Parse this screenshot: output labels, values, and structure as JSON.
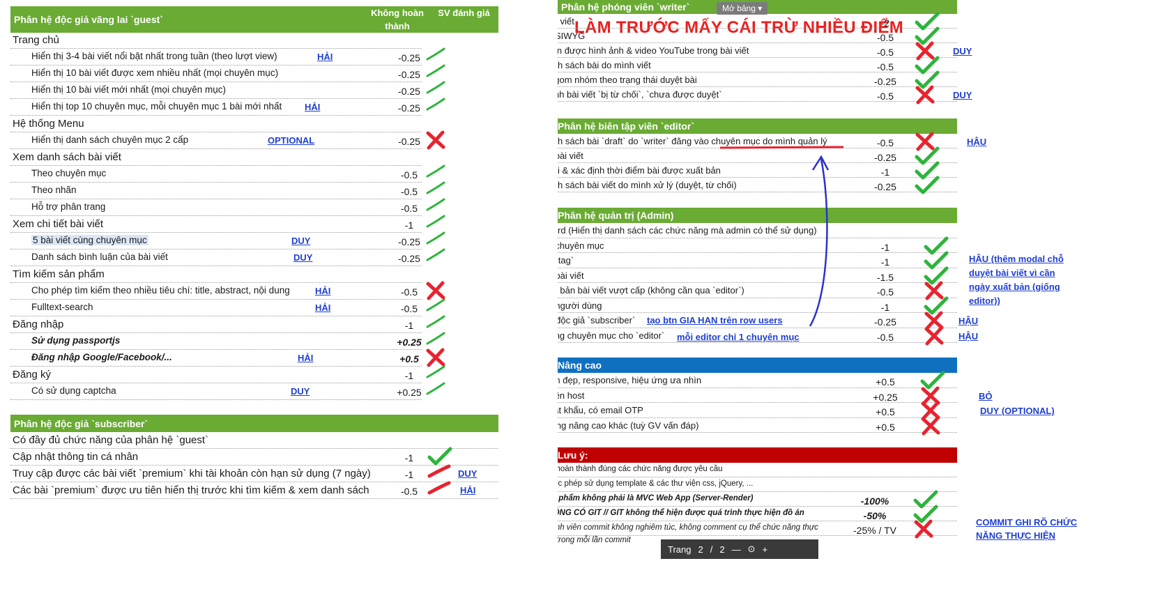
{
  "left": {
    "header1": {
      "title": "Phân hệ độc giả vãng lai `guest`",
      "col1": "Không hoàn thành",
      "col2": "SV đánh giá"
    },
    "rows": [
      {
        "type": "main",
        "label": "Trang chủ",
        "value": "",
        "mark": "",
        "note": ""
      },
      {
        "type": "sub",
        "label": "Hiển thị 3-4 bài viết nổi bật nhất trong tuần (theo lượt view)",
        "value": "-0.25",
        "mark": "green",
        "note": "HẢI"
      },
      {
        "type": "sub",
        "label": "Hiển thị 10 bài viết được xem nhiều nhất (mọi chuyên mục)",
        "value": "-0.25",
        "mark": "green",
        "note": ""
      },
      {
        "type": "sub",
        "label": "Hiển thị 10 bài viết mới nhất (mọi chuyên mục)",
        "value": "-0.25",
        "mark": "green",
        "note": ""
      },
      {
        "type": "sub",
        "label": "Hiển thị top 10 chuyên mục, mỗi chuyên mục 1 bài mới nhất",
        "value": "-0.25",
        "mark": "green",
        "note": "HẢI"
      },
      {
        "type": "main",
        "label": "Hệ thống Menu",
        "value": "",
        "mark": "",
        "note": ""
      },
      {
        "type": "sub",
        "label": "Hiển thị danh sách chuyên mục 2 cấp",
        "value": "-0.25",
        "mark": "red",
        "note": "OPTIONAL"
      },
      {
        "type": "main",
        "label": "Xem danh sách bài viết",
        "value": "",
        "mark": "",
        "note": ""
      },
      {
        "type": "sub",
        "label": "Theo chuyên mục",
        "value": "-0.5",
        "mark": "green",
        "note": ""
      },
      {
        "type": "sub",
        "label": "Theo nhãn",
        "value": "-0.5",
        "mark": "green",
        "note": ""
      },
      {
        "type": "sub",
        "label": "Hỗ trợ phân trang",
        "value": "-0.5",
        "mark": "green",
        "note": ""
      },
      {
        "type": "main",
        "label": "Xem chi tiết bài viết",
        "value": "-1",
        "mark": "green",
        "note": ""
      },
      {
        "type": "sub",
        "label": "5 bài viết cùng chuyên mục",
        "value": "-0.25",
        "mark": "green",
        "note": "DUY",
        "highlight": true
      },
      {
        "type": "sub",
        "label": "Danh sách bình luận của bài viết",
        "value": "-0.25",
        "mark": "green",
        "note": "DUY"
      },
      {
        "type": "main",
        "label": "Tìm kiếm sản phẩm",
        "value": "",
        "mark": "",
        "note": ""
      },
      {
        "type": "sub",
        "label": "Cho phép tìm kiếm theo nhiều tiêu chí: title, abstract, nội dung",
        "value": "-0.5",
        "mark": "red",
        "note": "HẢI"
      },
      {
        "type": "sub",
        "label": "Fulltext-search",
        "value": "-0.5",
        "mark": "green",
        "note": "HẢI"
      },
      {
        "type": "main",
        "label": "Đăng nhập",
        "value": "-1",
        "mark": "green",
        "note": ""
      },
      {
        "type": "sub",
        "label": "Sử dụng passportjs",
        "value": "+0.25",
        "mark": "green",
        "note": "",
        "bold": true
      },
      {
        "type": "sub",
        "label": "Đăng nhập Google/Facebook/...",
        "value": "+0.5",
        "mark": "red",
        "note": "HẢI",
        "bold": true
      },
      {
        "type": "main",
        "label": "Đăng ký",
        "value": "-1",
        "mark": "green",
        "note": ""
      },
      {
        "type": "sub",
        "label": "Có sử dụng captcha",
        "value": "+0.25",
        "mark": "green",
        "note": "DUY"
      }
    ],
    "header2": {
      "title": "Phân hệ độc giả `subscriber`"
    },
    "rows2": [
      {
        "type": "main",
        "label": "Có đầy đủ chức năng của phân hệ `guest`",
        "value": "",
        "mark": "",
        "note": ""
      },
      {
        "type": "main",
        "label": "Cập nhật thông tin cá nhân",
        "value": "-1",
        "mark": "green",
        "note": ""
      },
      {
        "type": "main",
        "label": "Truy cập được các bài viết `premium` khi tài khoản còn hạn sử dụng (7 ngày)",
        "value": "-1",
        "mark": "redline",
        "note": "DUY"
      },
      {
        "type": "main",
        "label": "Các bài `premium` được ưu tiên hiển thị trước khi tìm kiếm & xem danh sách",
        "value": "-0.5",
        "mark": "redline",
        "note": "HẢI"
      }
    ]
  },
  "right": {
    "banner": "LÀM TRƯỚC MẤY CÁI TRỪ NHIỀU ĐIỂM",
    "open_table": "Mở bảng",
    "writer": {
      "title": "Phân hệ phóng viên `writer`",
      "rows": [
        {
          "type": "main",
          "label": "Đăng bài viết",
          "value": "-2",
          "mark": "green",
          "note": ""
        },
        {
          "type": "sub",
          "label": "WYSIWYG",
          "value": "-0.5",
          "mark": "green",
          "note": ""
        },
        {
          "type": "sub",
          "label": "Chèn được hình ảnh & video YouTube trong bài viết",
          "value": "-0.5",
          "mark": "red",
          "note": "DUY"
        },
        {
          "type": "main",
          "label": "Xem danh sách bài do mình viết",
          "value": "-0.5",
          "mark": "green",
          "note": ""
        },
        {
          "type": "sub",
          "label": "Có gom nhóm theo trạng thái duyệt bài",
          "value": "-0.25",
          "mark": "green",
          "note": ""
        },
        {
          "type": "main",
          "label": "Hiệu chỉnh bài viết `bị từ chối`, `chưa được duyệt`",
          "value": "-0.5",
          "mark": "red",
          "note": "DUY"
        }
      ]
    },
    "editor": {
      "title": "Phân hệ biên tập viên `editor`",
      "rows": [
        {
          "type": "main",
          "label": "Xem danh sách bài `draft` do `writer` đăng vào chuyên mục do mình quản lý",
          "value": "-0.5",
          "mark": "red",
          "note": "HẬU"
        },
        {
          "type": "main",
          "label": "Từ chối bài viết",
          "value": "-0.25",
          "mark": "green",
          "note": ""
        },
        {
          "type": "main",
          "label": "Duyệt bài & xác định thời điểm bài được xuất bản",
          "value": "-1",
          "mark": "green",
          "note": ""
        },
        {
          "type": "main",
          "label": "Xem danh sách bài viết do mình xử lý (duyệt, từ chối)",
          "value": "-0.25",
          "mark": "green",
          "note": ""
        }
      ]
    },
    "admin": {
      "title": "Phân hệ quản trị (Admin)",
      "rows": [
        {
          "type": "main",
          "label": "Dashboard (Hiển thị danh sách các chức năng mà admin có thể sử dụng)",
          "value": "",
          "mark": "",
          "note": ""
        },
        {
          "type": "main",
          "label": "Quản lý chuyên mục",
          "value": "-1",
          "mark": "green",
          "note": ""
        },
        {
          "type": "main",
          "label": "Quản lý `tag`",
          "value": "-1",
          "mark": "green",
          "note": ""
        },
        {
          "type": "main",
          "label": "Quản lý bài viết",
          "value": "-1.5",
          "mark": "green",
          "note": ""
        },
        {
          "type": "sub",
          "label": "Xuất bản bài viết vượt cấp (không cần qua `editor`)",
          "value": "-0.5",
          "mark": "red",
          "note": ""
        },
        {
          "type": "main",
          "label": "Quản lý người dùng",
          "value": "-1",
          "mark": "green",
          "note": ""
        },
        {
          "type": "main",
          "label": "Gia hạn độc giả `subscriber`",
          "value": "-0.25",
          "mark": "red",
          "note": "HẬU"
        },
        {
          "type": "main",
          "label": "Phân công chuyên mục cho `editor`",
          "value": "-0.5",
          "mark": "red",
          "note": "HẬU"
        }
      ],
      "side_note": "HẬU (thêm modal chỗ duyệt bài viết vì cần ngày xuất bản (giống editor))",
      "inline_note1": "tạo btn GIA HẠN trên row users",
      "inline_note2": "mỗi editor chỉ 1 chuyên mục"
    },
    "advanced": {
      "title": "Nâng cao",
      "rows": [
        {
          "type": "main",
          "label": "Giao diện đẹp, responsive, hiệu ứng ưa nhìn",
          "value": "+0.5",
          "mark": "green",
          "note": ""
        },
        {
          "type": "main",
          "label": "Upload lên host",
          "value": "+0.25",
          "mark": "red",
          "note": "BỎ"
        },
        {
          "type": "main",
          "label": "Quên mật khẩu, có email OTP",
          "value": "+0.5",
          "mark": "red",
          "note": "DUY (OPTIONAL)"
        },
        {
          "type": "main",
          "label": "Chức năng nâng cao khác (tuỳ GV vấn đáp)",
          "value": "+0.5",
          "mark": "red",
          "note": ""
        }
      ]
    },
    "notes": {
      "title": "Lưu ý:",
      "rows": [
        {
          "label": "Chỉ hoàn thành đúng các chức năng được yêu cầu",
          "value": "",
          "mark": ""
        },
        {
          "label": "Được phép sử dụng template & các thư viện css, jQuery, ...",
          "value": "",
          "mark": ""
        },
        {
          "label": "Sản phẩm không phải là MVC Web App (Server-Render)",
          "value": "-100%",
          "mark": "green",
          "bold": true
        },
        {
          "label": "KHÔNG CÓ GIT // GIT không thể hiện được quá trình thực hiện đồ án",
          "value": "-50%",
          "mark": "green",
          "bold": true
        },
        {
          "label": "Thành viên commit không nghiêm túc, không comment cụ thể chức năng thực",
          "label2": "hiện trong mỗi lần commit",
          "value": "-25% / TV",
          "mark": "red"
        }
      ],
      "side_note": "COMMIT GHI RÕ CHỨC NĂNG THỰC HIỆN"
    },
    "pager": {
      "label": "Trang",
      "page": "2",
      "sep": "/",
      "total": "2",
      "minus": "—",
      "zoom": "⊙",
      "plus": "+"
    }
  },
  "colors": {
    "green_header": "#6aab34",
    "blue_header": "#0f70c0",
    "red_header": "#c00000",
    "note": "#1f3fcf",
    "check": "#2db43b",
    "cross": "#e8232f",
    "banner": "#ef1c1c"
  }
}
